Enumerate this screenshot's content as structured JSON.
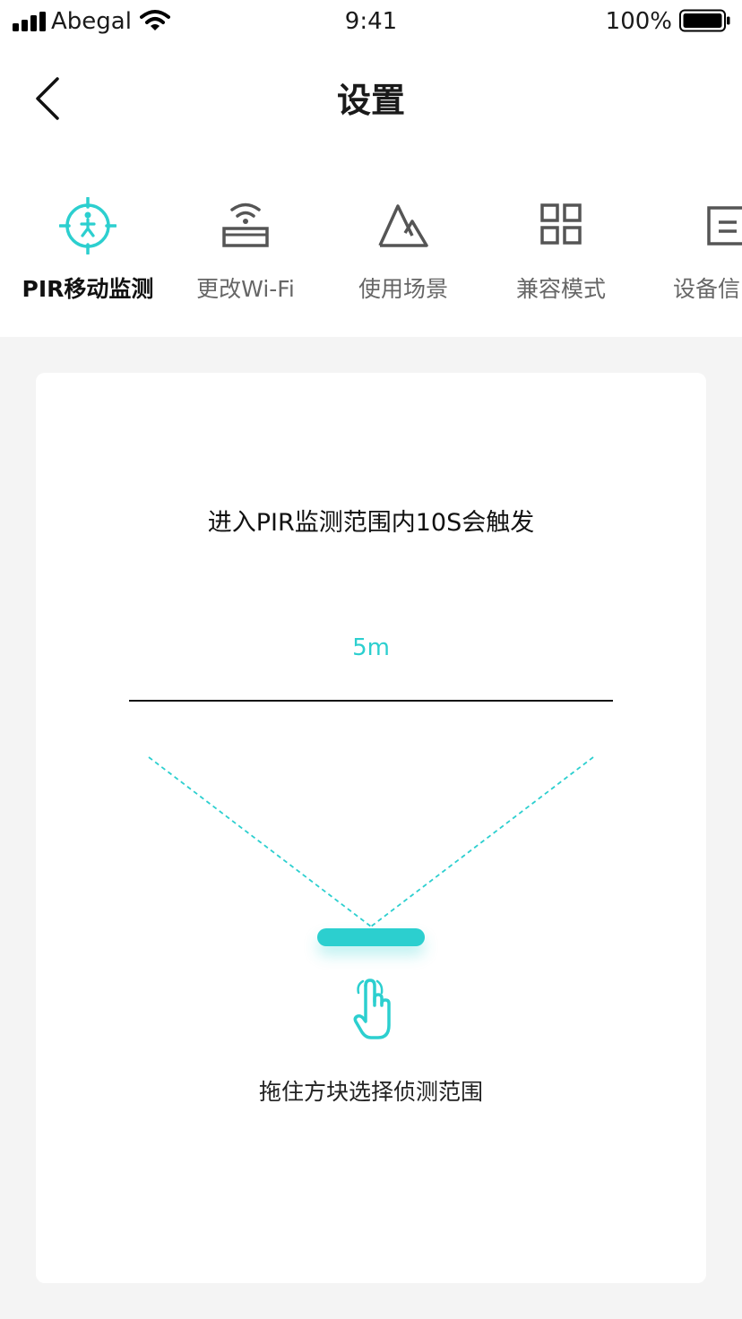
{
  "status_bar": {
    "carrier": "Abegal",
    "time": "9:41",
    "battery": "100%"
  },
  "header": {
    "title": "设置"
  },
  "tabs": [
    {
      "label": "PIR移动监测",
      "icon": "motion-detect-icon",
      "active": true
    },
    {
      "label": "更改Wi-Fi",
      "icon": "wifi-router-icon",
      "active": false
    },
    {
      "label": "使用场景",
      "icon": "mountain-scene-icon",
      "active": false
    },
    {
      "label": "兼容模式",
      "icon": "grid-icon",
      "active": false
    },
    {
      "label": "设备信",
      "icon": "device-info-icon",
      "active": false
    }
  ],
  "pir": {
    "headline": "进入PIR监测范围内10S会触发",
    "distance": "5m",
    "hint": "拖住方块选择侦测范围"
  },
  "colors": {
    "accent": "#2ccfcf",
    "background": "#f4f4f4",
    "card": "#ffffff",
    "text": "#1a1a1a"
  }
}
